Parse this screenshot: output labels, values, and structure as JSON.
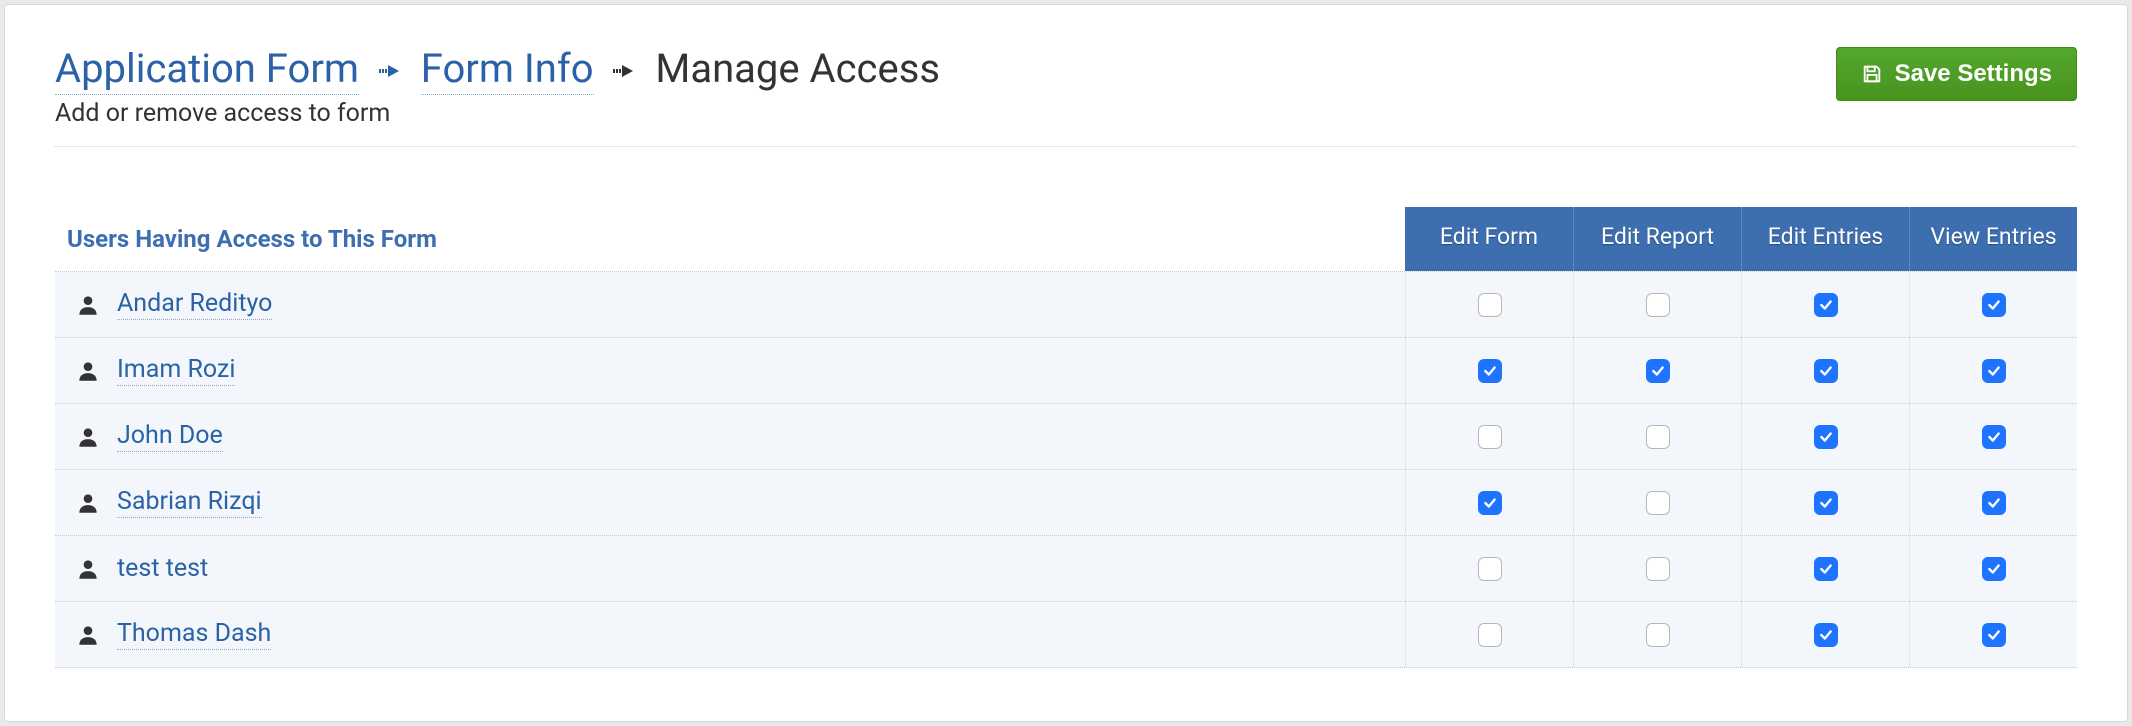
{
  "breadcrumb": {
    "items": [
      {
        "label": "Application Form",
        "link": true
      },
      {
        "label": "Form Info",
        "link": true
      },
      {
        "label": "Manage Access",
        "link": false
      }
    ],
    "subtitle": "Add or remove access to form"
  },
  "actions": {
    "save_label": "Save Settings"
  },
  "table": {
    "users_header": "Users Having Access to This Form",
    "columns": [
      "Edit Form",
      "Edit Report",
      "Edit Entries",
      "View Entries"
    ],
    "rows": [
      {
        "name": "Andar Redityo",
        "link": true,
        "perms": [
          false,
          false,
          true,
          true
        ]
      },
      {
        "name": "Imam Rozi",
        "link": true,
        "perms": [
          true,
          true,
          true,
          true
        ]
      },
      {
        "name": "John Doe",
        "link": true,
        "perms": [
          false,
          false,
          true,
          true
        ]
      },
      {
        "name": "Sabrian Rizqi",
        "link": true,
        "perms": [
          true,
          false,
          true,
          true
        ]
      },
      {
        "name": "test test",
        "link": false,
        "perms": [
          false,
          false,
          true,
          true
        ]
      },
      {
        "name": "Thomas Dash",
        "link": true,
        "perms": [
          false,
          false,
          true,
          true
        ]
      }
    ]
  }
}
